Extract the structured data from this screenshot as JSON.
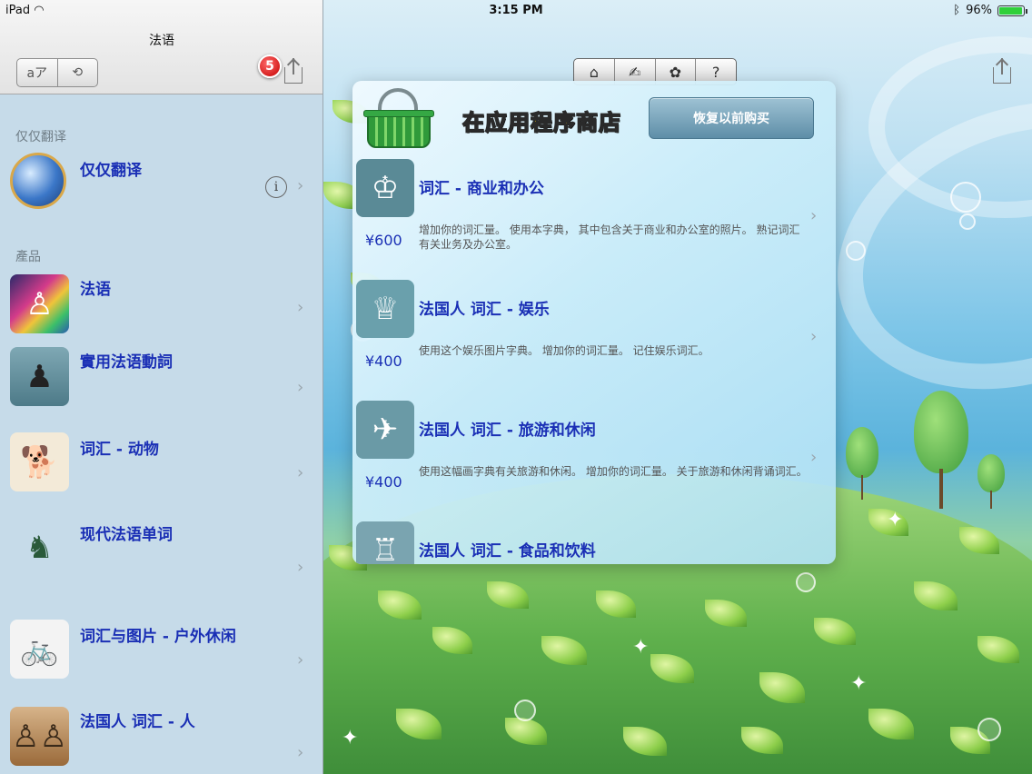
{
  "status_bar": {
    "device": "iPad",
    "time": "3:15 PM",
    "battery": "96%",
    "battery_level": 0.96
  },
  "left_panel": {
    "title": "法语",
    "segment": [
      "aア",
      "⟲"
    ],
    "badge": "5",
    "sections": [
      {
        "header": "仅仅翻译",
        "items": [
          {
            "label": "仅仅翻译",
            "icon": "globe-icon"
          }
        ]
      },
      {
        "header": "產品",
        "items": [
          {
            "label": "法语",
            "icon": "rainbow-figure-icon"
          },
          {
            "label": "實用法语動詞",
            "icon": "waiter-icon"
          },
          {
            "label": "词汇 - 动物",
            "icon": "dog-icon"
          },
          {
            "label": "现代法语单词",
            "icon": "frenchman-icon"
          },
          {
            "label": "词汇与图片 - 户外休闲",
            "icon": "cyclist-icon"
          },
          {
            "label": "法国人 词汇 - 人",
            "icon": "people-icon"
          }
        ]
      }
    ]
  },
  "toolbar": {
    "tabs": [
      "home-icon",
      "figure-icon",
      "gear-icon",
      "help-icon"
    ],
    "tab_glyphs": [
      "⌂",
      "✍",
      "✿",
      "?"
    ]
  },
  "store": {
    "title": "在应用程序商店",
    "restore_label": "恢复以前购买",
    "products": [
      {
        "title": "词汇 - 商业和办公",
        "price": "¥600",
        "description": "增加你的词汇量。 使用本字典， 其中包含关于商业和办公室的照片。 熟记词汇有关业务及办公室。",
        "icon": "office-worker-icon"
      },
      {
        "title": "法国人 词汇 - 娱乐",
        "price": "¥400",
        "description": "使用这个娱乐图片字典。 增加你的词汇量。 记住娱乐词汇。",
        "icon": "lady-reading-icon"
      },
      {
        "title": "法国人 词汇 - 旅游和休闲",
        "price": "¥400",
        "description": "使用这幅画字典有关旅游和休闲。 增加你的词汇量。 关于旅游和休闲背诵词汇。",
        "icon": "traveler-icon"
      },
      {
        "title": "法国人 词汇 - 食品和饮料",
        "price": "",
        "description": "",
        "icon": "diner-icon"
      }
    ]
  },
  "colors": {
    "link_blue": "#1a2fb5",
    "store_title_yellow": "#ffe100",
    "badge_red": "#d40000"
  }
}
